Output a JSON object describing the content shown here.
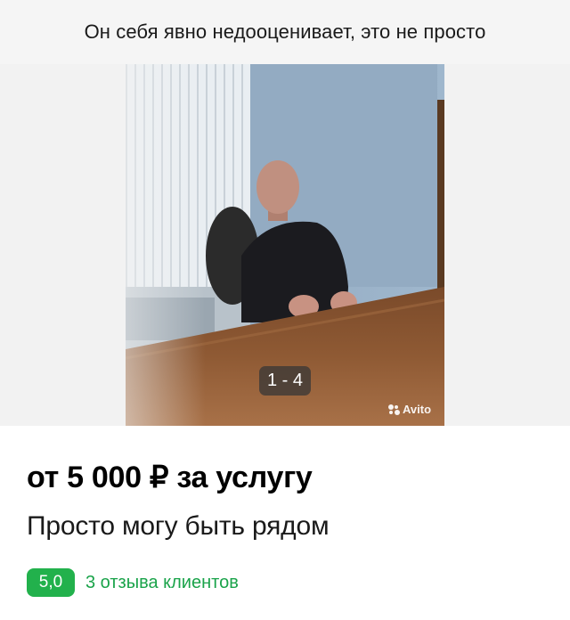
{
  "caption": "Он себя явно недооценивает, это не просто",
  "listing": {
    "gallery_counter": "1 - 4",
    "watermark": "Avito",
    "price": "от 5 000 ₽ за услугу",
    "title": "Просто могу быть рядом",
    "rating": "5,0",
    "reviews": "3 отзыва клиентов"
  },
  "colors": {
    "rating_badge": "#22b14c",
    "reviews_link": "#1aa34a",
    "caption_background": "#f5f5f5"
  }
}
